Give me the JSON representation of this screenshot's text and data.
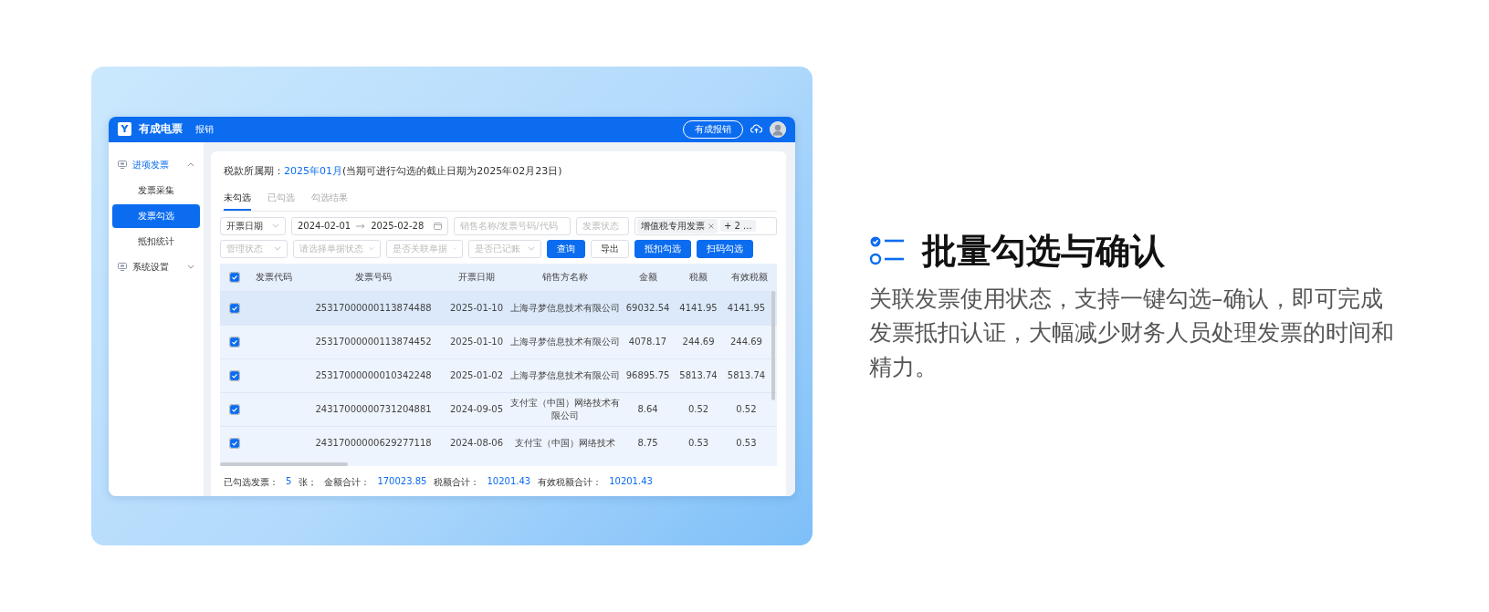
{
  "app": {
    "topbar": {
      "logo_mark": "Y",
      "brand": "有成电票",
      "nav": "报销",
      "button": "有成报销"
    },
    "sidebar": {
      "items": [
        {
          "label": "进项发票",
          "expanded": true,
          "children": [
            {
              "label": "发票采集",
              "selected": false
            },
            {
              "label": "发票勾选",
              "selected": true
            },
            {
              "label": "抵扣统计",
              "selected": false
            }
          ]
        },
        {
          "label": "系统设置",
          "expanded": false
        }
      ]
    },
    "period": {
      "label": "税款所属期：",
      "value": "2025年01月",
      "note": "(当期可进行勾选的截止日期为2025年02月23日)"
    },
    "tabs": [
      {
        "label": "未勾选",
        "selected": true
      },
      {
        "label": "已勾选",
        "selected": false
      },
      {
        "label": "勾选结果",
        "selected": false
      }
    ],
    "filters": {
      "date_type": "开票日期",
      "date_from": "2024-02-01",
      "date_to": "2025-02-28",
      "search": {
        "placeholder": "销售名称/发票号码/代码"
      },
      "invoice_status": {
        "placeholder": "发票状态"
      },
      "invoice_types": {
        "tags": [
          "增值税专用发票"
        ],
        "more": "+ 2 ..."
      },
      "selects": [
        {
          "placeholder": "管理状态"
        },
        {
          "placeholder": "请选择单据状态"
        },
        {
          "placeholder": "是否关联单据"
        },
        {
          "placeholder": "是否已记账"
        }
      ],
      "buttons": [
        {
          "label": "查询",
          "kind": "primary"
        },
        {
          "label": "导出",
          "kind": "default"
        },
        {
          "label": "抵扣勾选",
          "kind": "primary"
        },
        {
          "label": "扫码勾选",
          "kind": "primary"
        }
      ]
    },
    "table": {
      "all_checked": true,
      "columns": [
        "发票代码",
        "发票号码",
        "开票日期",
        "销售方名称",
        "金额",
        "税额",
        "有效税额"
      ],
      "rows": [
        {
          "checked": true,
          "highlighted": true,
          "number": "25317000000113874488",
          "date": "2025-01-10",
          "seller": "上海寻梦信息技术有限公司",
          "amount": "69032.54",
          "tax": "4141.95",
          "valid_tax": "4141.95"
        },
        {
          "checked": true,
          "highlighted": false,
          "number": "25317000000113874452",
          "date": "2025-01-10",
          "seller": "上海寻梦信息技术有限公司",
          "amount": "4078.17",
          "tax": "244.69",
          "valid_tax": "244.69"
        },
        {
          "checked": true,
          "highlighted": false,
          "number": "25317000000010342248",
          "date": "2025-01-02",
          "seller": "上海寻梦信息技术有限公司",
          "amount": "96895.75",
          "tax": "5813.74",
          "valid_tax": "5813.74"
        },
        {
          "checked": true,
          "highlighted": false,
          "number": "24317000000731204881",
          "date": "2024-09-05",
          "seller": "支付宝（中国）网络技术有限公司",
          "amount": "8.64",
          "tax": "0.52",
          "valid_tax": "0.52"
        },
        {
          "checked": true,
          "highlighted": false,
          "number": "24317000000629277118",
          "date": "2024-08-06",
          "seller": "支付宝（中国）网络技术",
          "amount": "8.75",
          "tax": "0.53",
          "valid_tax": "0.53"
        }
      ]
    },
    "footer": [
      {
        "label": "已勾选发票：",
        "value": "5",
        "unit": "张；"
      },
      {
        "label": "金额合计：",
        "value": "170023.85"
      },
      {
        "label": "税额合计：",
        "value": "10201.43"
      },
      {
        "label": "有效税额合计：",
        "value": "10201.43"
      }
    ]
  },
  "feature": {
    "title": "批量勾选与确认",
    "description": "关联发票使用状态，支持一键勾选–确认，即可完成发票抵扣认证，大幅减少财务人员处理发票的时间和精力。"
  }
}
